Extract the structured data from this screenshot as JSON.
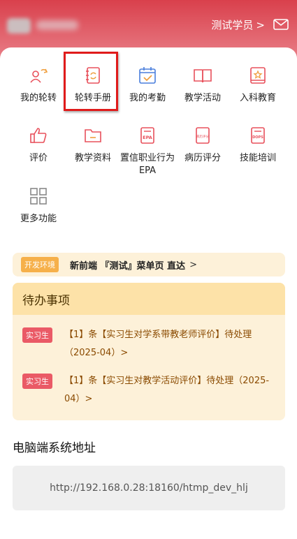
{
  "header": {
    "user_role": "测试学员",
    "role_chevron": ">",
    "mail_icon": "mail-icon"
  },
  "functions": [
    {
      "label": "我的轮转",
      "icon": "rotation-icon"
    },
    {
      "label": "轮转手册",
      "icon": "handbook-icon"
    },
    {
      "label": "我的考勤",
      "icon": "calendar-check-icon"
    },
    {
      "label": "教学活动",
      "icon": "book-open-icon"
    },
    {
      "label": "入科教育",
      "icon": "star-book-icon"
    },
    {
      "label": "评价",
      "icon": "thumbs-up-icon"
    },
    {
      "label": "教学资料",
      "icon": "folder-icon"
    },
    {
      "label": "置信职业行为EPA",
      "icon": "epa-icon"
    },
    {
      "label": "病历评分",
      "icon": "record-score-icon"
    },
    {
      "label": "技能培训",
      "icon": "dops-icon"
    },
    {
      "label": "更多功能",
      "icon": "grid-more-icon"
    }
  ],
  "icon_text": {
    "epa": "EPA",
    "record": "病历评分",
    "dops": "DOPS"
  },
  "dev_banner": {
    "tag": "开发环境",
    "text": "新前端 『测试』菜单页 直达",
    "arrow": ">"
  },
  "todo": {
    "title": "待办事项",
    "items": [
      {
        "tag": "实习生",
        "text": "【1】条【实习生对学系带教老师评价】待处理（2025-04）>"
      },
      {
        "tag": "实习生",
        "text": "【1】条【实习生对教学活动评价】待处理（2025-04）>"
      }
    ]
  },
  "pc": {
    "title": "电脑端系统地址",
    "url": "http://192.168.0.28:18160/htmp_dev_hlj"
  },
  "colors": {
    "primary": "#d9404c",
    "icon": "#e8505b",
    "banner_bg": "#fdf1d9",
    "banner_tag": "#f6b04a",
    "todo_head": "#fde2a8",
    "todo_tag": "#ea5a66",
    "todo_text": "#8a4a00",
    "highlight": "#e01b1b"
  }
}
